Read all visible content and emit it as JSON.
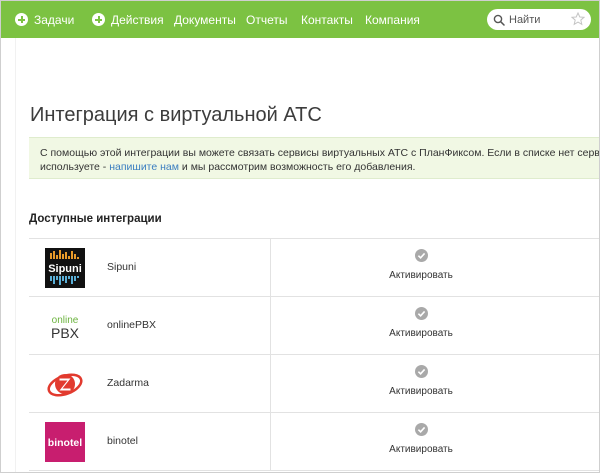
{
  "nav": {
    "tasks": "Задачи",
    "actions": "Действия",
    "documents": "Документы",
    "reports": "Отчеты",
    "contacts": "Контакты",
    "company": "Компания",
    "search_placeholder": "Найти"
  },
  "page": {
    "title": "Интеграция с виртуальной АТС",
    "notice_line1": "С помощью этой интеграции вы можете связать сервисы виртуальных АТС с ПланФиксом. Если в списке нет сервиса, который вы",
    "notice_line2_prefix": "используете - ",
    "notice_link": "напишите нам",
    "notice_line2_suffix": " и мы рассмотрим возможность его добавления.",
    "section_title": "Доступные интеграции"
  },
  "integrations": [
    {
      "name": "Sipuni",
      "logo_text": "Sipuni",
      "action": "Активировать"
    },
    {
      "name": "onlinePBX",
      "logo_text_top": "online",
      "logo_text_bottom": "PBX",
      "action": "Активировать"
    },
    {
      "name": "Zadarma",
      "action": "Активировать"
    },
    {
      "name": "binotel",
      "logo_text": "binotel",
      "action": "Активировать"
    }
  ],
  "colors": {
    "topbar": "#7cc242",
    "notice_bg": "#f1f8e4",
    "link": "#3a7dc0",
    "check": "#a9a9a9",
    "zadarma": "#e23a2e",
    "binotel": "#c81e6f",
    "onlinepbx_green": "#6cb33f"
  },
  "icons": {
    "nav_tasks": "plus-circle-icon",
    "nav_actions": "plus-circle-icon",
    "search": "search-icon",
    "favorite": "star-icon",
    "activate": "check-circle-icon"
  }
}
